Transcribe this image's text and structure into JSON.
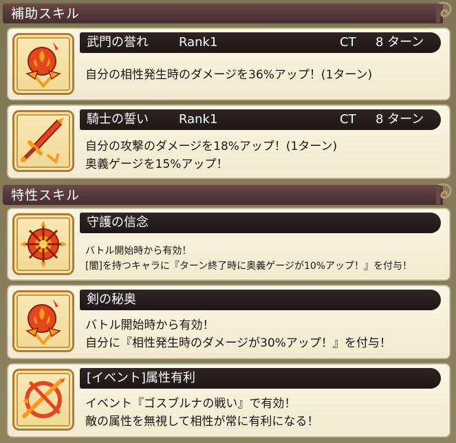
{
  "sections": [
    {
      "title": "補助スキル"
    },
    {
      "title": "特性スキル"
    }
  ],
  "support_skills": [
    {
      "name": "武門の誉れ",
      "rank": "Rank1",
      "ct_label": "CT",
      "turns": "8 ターン",
      "icon": "flame-emblem-icon",
      "lines": [
        "自分の相性発生時のダメージを36%アップ！(1ターン)"
      ]
    },
    {
      "name": "騎士の誓い",
      "rank": "Rank1",
      "ct_label": "CT",
      "turns": "8 ターン",
      "icon": "sword-icon",
      "lines": [
        "自分の攻撃のダメージを18%アップ！(1ターン)",
        "奥義ゲージを15%アップ！"
      ]
    }
  ],
  "trait_skills": [
    {
      "name": "守護の信念",
      "icon": "sun-shield-icon",
      "lines": [
        "バトル開始時から有効！",
        "[闇]を持つキャラに『ターン終了時に奥義ゲージが10%アップ！』を付与！"
      ]
    },
    {
      "name": "剣の秘奥",
      "icon": "flame-emblem-icon",
      "lines": [
        "バトル開始時から有効！",
        "自分に『相性発生時のダメージが30%アップ！』を付与！"
      ]
    },
    {
      "name": "[イベント]属性有利",
      "icon": "crossed-star-icon",
      "lines": [
        "イベント『ゴスブルナの戦い』で有効！",
        "敵の属性を無視して相性が常に有利になる！"
      ]
    }
  ],
  "colors": {
    "background": "#8a7f5c",
    "header": "#54373a",
    "titlebar": "#241b1a",
    "card": "#f8f1dc",
    "icon_red": "#e2471d",
    "icon_orange": "#f59a1e"
  }
}
